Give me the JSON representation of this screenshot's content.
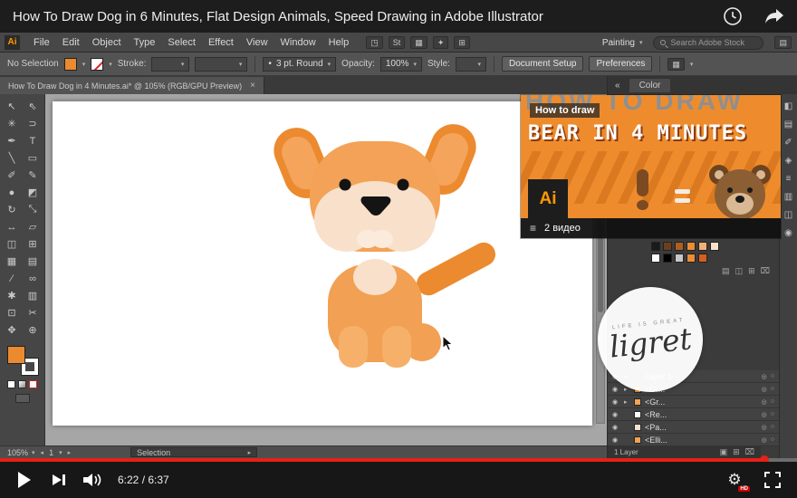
{
  "colors": {
    "ai-orange": "#ff9a00",
    "yt-red": "#e62117",
    "ear": "#ec8a2f",
    "ear-inner": "#f5a55b",
    "head": "#f3a257",
    "body": "#f2a053",
    "paw": "#f6b06a",
    "muzzle": "#f8e0cb",
    "chin": "#fbebdc",
    "ink": "#141414",
    "card-bg": "#ee8c2d",
    "card-zig": "#c96a14",
    "bear-head": "#8c5e33",
    "bear-ear": "#6e4420",
    "bear-muzzle": "#d9b894"
  },
  "titlebar": {
    "title": "How To Draw Dog in 6 Minutes, Flat Design Animals, Speed Drawing in Adobe Illustrator"
  },
  "player": {
    "time": "6:22 / 6:37",
    "hd": "HD",
    "progress_percent": 96
  },
  "card": {
    "bg_text": "HOW TO DRAW",
    "label": "How to draw",
    "headline": "BEAR IN 4 MINUTES",
    "logo": "Ai",
    "playlist": "2 видео"
  },
  "watermark": {
    "arc": "LIFE IS GREAT",
    "name": "ligret"
  },
  "ai": {
    "logo": "Ai",
    "menus": [
      "File",
      "Edit",
      "Object",
      "Type",
      "Select",
      "Effect",
      "View",
      "Window",
      "Help"
    ],
    "menubar_buttons": [
      "◳",
      "St",
      "▦",
      "✦",
      "⊞"
    ],
    "workspace": "Painting",
    "search": "Search Adobe Stock",
    "control": {
      "no_selection": "No Selection",
      "stroke_label": "Stroke:",
      "brush": "3 pt. Round",
      "opacity_label": "Opacity:",
      "opacity": "100%",
      "style_label": "Style:",
      "doc_setup": "Document Setup",
      "preferences": "Preferences"
    },
    "tab": {
      "title": "How To Draw Dog in 4 Minutes.ai* @ 105% (RGB/GPU Preview)",
      "close": "×"
    },
    "tools": [
      {
        "name": "selection-tool",
        "glyph": "↖"
      },
      {
        "name": "direct-selection-tool",
        "glyph": "⇖"
      },
      {
        "name": "magic-wand-tool",
        "glyph": "✳"
      },
      {
        "name": "lasso-tool",
        "glyph": "⊃"
      },
      {
        "name": "pen-tool",
        "glyph": "✒"
      },
      {
        "name": "type-tool",
        "glyph": "T"
      },
      {
        "name": "line-segment-tool",
        "glyph": "╲"
      },
      {
        "name": "rectangle-tool",
        "glyph": "▭"
      },
      {
        "name": "paintbrush-tool",
        "glyph": "✐"
      },
      {
        "name": "pencil-tool",
        "glyph": "✎"
      },
      {
        "name": "blob-brush-tool",
        "glyph": "●"
      },
      {
        "name": "eraser-tool",
        "glyph": "◩"
      },
      {
        "name": "rotate-tool",
        "glyph": "↻"
      },
      {
        "name": "scale-tool",
        "glyph": "⤡"
      },
      {
        "name": "width-tool",
        "glyph": "↔"
      },
      {
        "name": "free-transform-tool",
        "glyph": "▱"
      },
      {
        "name": "shape-builder-tool",
        "glyph": "◫"
      },
      {
        "name": "perspective-grid-tool",
        "glyph": "⊞"
      },
      {
        "name": "mesh-tool",
        "glyph": "▦"
      },
      {
        "name": "gradient-tool",
        "glyph": "▤"
      },
      {
        "name": "eyedropper-tool",
        "glyph": "∕"
      },
      {
        "name": "blend-tool",
        "glyph": "∞"
      },
      {
        "name": "symbol-sprayer-tool",
        "glyph": "✱"
      },
      {
        "name": "column-graph-tool",
        "glyph": "▥"
      },
      {
        "name": "artboard-tool",
        "glyph": "⊡"
      },
      {
        "name": "slice-tool",
        "glyph": "✂"
      },
      {
        "name": "hand-tool",
        "glyph": "✥"
      },
      {
        "name": "zoom-tool",
        "glyph": "⊕"
      }
    ],
    "status": {
      "zoom": "105%",
      "artboard": "1",
      "tool": "Selection"
    },
    "panels": {
      "color_tab": "Color",
      "side_icons": [
        {
          "name": "color-panel-icon",
          "glyph": "◧"
        },
        {
          "name": "swatches-panel-icon",
          "glyph": "▤"
        },
        {
          "name": "brushes-panel-icon",
          "glyph": "✐"
        },
        {
          "name": "symbols-panel-icon",
          "glyph": "◈"
        },
        {
          "name": "stroke-panel-icon",
          "glyph": "≡"
        },
        {
          "name": "gradient-panel-icon",
          "glyph": "▥"
        },
        {
          "name": "transparency-panel-icon",
          "glyph": "◫"
        },
        {
          "name": "appearance-panel-icon",
          "glyph": "◉"
        }
      ],
      "swatch_row1": [
        "#1a1a1a",
        "#6b3f1d",
        "#b05e1f",
        "#ec8c34",
        "#f2b079",
        "#f8e0cb"
      ],
      "swatch_row2": [
        "#ffffff",
        "#000000",
        "#c8c8c8",
        "#ec8c34",
        "#d65f1e"
      ],
      "layers": {
        "rows": [
          {
            "arrow": "▾",
            "label": "Layer 1",
            "chip": ""
          },
          {
            "arrow": "▸",
            "label": "<Gr...",
            "chip": "#ec8c34"
          },
          {
            "arrow": "▸",
            "label": "<Gr...",
            "chip": "#f3a257"
          },
          {
            "arrow": "",
            "label": "<Re...",
            "chip": "#ffffff"
          },
          {
            "arrow": "",
            "label": "<Pa...",
            "chip": "#f8e0cb"
          },
          {
            "arrow": "",
            "label": "<Elli...",
            "chip": "#f2a053"
          }
        ],
        "footer": "1 Layer"
      }
    }
  }
}
